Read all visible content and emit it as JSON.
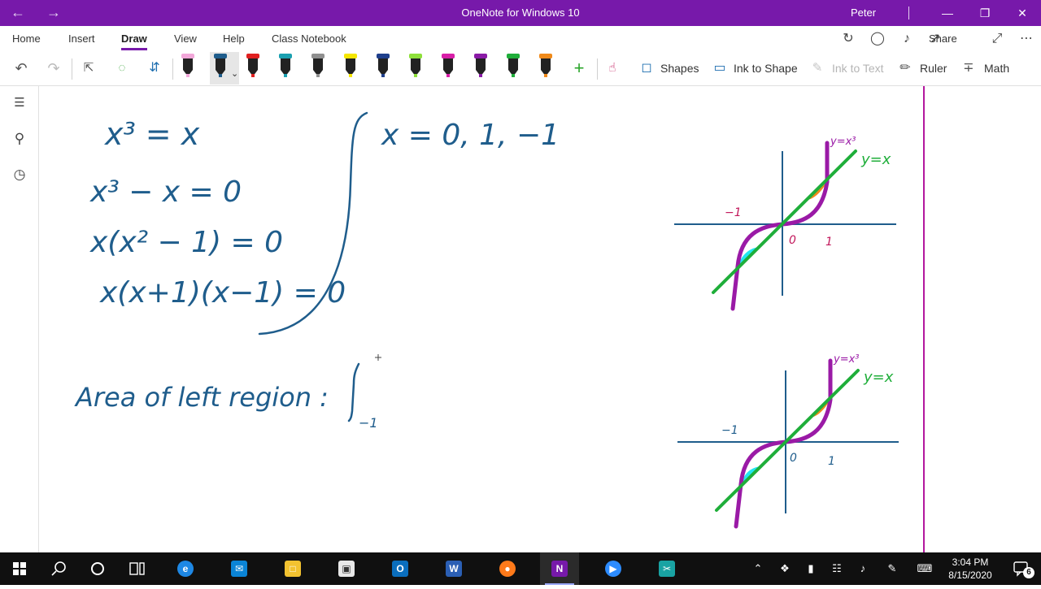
{
  "titlebar": {
    "title": "OneNote for Windows 10",
    "user": "Peter",
    "accent": "#7719aa"
  },
  "tabs": [
    {
      "label": "Home"
    },
    {
      "label": "Insert"
    },
    {
      "label": "Draw",
      "active": true
    },
    {
      "label": "View"
    },
    {
      "label": "Help"
    },
    {
      "label": "Class Notebook"
    }
  ],
  "ribbon_right": {
    "share_label": "Share",
    "icons": [
      "sync-icon",
      "lightbulb-icon",
      "bell-icon",
      "share-icon",
      "expand-icon",
      "more-icon"
    ]
  },
  "toolbar": {
    "shapes_label": "Shapes",
    "ink_to_shape_label": "Ink to Shape",
    "ink_to_text_label": "Ink to Text",
    "ruler_label": "Ruler",
    "math_label": "Math",
    "pens": [
      {
        "name": "highlighter-pink",
        "color": "#f2a7d9"
      },
      {
        "name": "pen-dark-blue",
        "color": "#1f5d8c",
        "selected": true
      },
      {
        "name": "pen-red",
        "color": "#e02020"
      },
      {
        "name": "pen-teal",
        "color": "#1aa0b0"
      },
      {
        "name": "pen-gray",
        "color": "#909090"
      },
      {
        "name": "highlighter-yellow",
        "color": "#f5e600"
      },
      {
        "name": "pen-navy",
        "color": "#1f3f8c"
      },
      {
        "name": "pen-lime",
        "color": "#8ee03a"
      },
      {
        "name": "pen-magenta",
        "color": "#d81fa8"
      },
      {
        "name": "pen-purple",
        "color": "#8a1aa6"
      },
      {
        "name": "pen-green",
        "color": "#1fae3a"
      },
      {
        "name": "highlighter-orange",
        "color": "#f08a1a"
      }
    ]
  },
  "notes": {
    "eq1": "x³ = x",
    "eq2": "x³ − x = 0",
    "eq3": "x(x² − 1) = 0",
    "eq4": "x(x+1)(x−1) = 0",
    "roots": "x = 0, 1, −1",
    "area_text": "Area of left region :",
    "integral_lower": "−1",
    "graph1": {
      "label_cubic": "y=x³",
      "label_line": "y=x",
      "tick_neg": "−1",
      "tick_zero": "0",
      "tick_pos": "1"
    },
    "graph2": {
      "label_cubic": "y=x³",
      "label_line": "y=x",
      "tick_neg": "−1",
      "tick_zero": "0",
      "tick_pos": "1"
    }
  },
  "ink_colors": {
    "pen": "#1f5d8c",
    "axis": "#1f5d8c",
    "cubic": "#9a1aa6",
    "line": "#1fae3a",
    "fill_left": "#22e6f0",
    "fill_right": "#f08a1a",
    "ticks": "#c2185b",
    "margin": "#b3179e"
  },
  "taskbar": {
    "time": "3:04 PM",
    "date": "8/15/2020",
    "notification_count": "6",
    "apps": [
      {
        "name": "windows-start-icon"
      },
      {
        "name": "search-icon"
      },
      {
        "name": "cortana-icon"
      },
      {
        "name": "task-view-icon"
      },
      {
        "name": "edge-icon"
      },
      {
        "name": "mail-icon"
      },
      {
        "name": "file-explorer-icon"
      },
      {
        "name": "store-icon"
      },
      {
        "name": "outlook-icon",
        "glyph": "O"
      },
      {
        "name": "word-icon",
        "glyph": "W"
      },
      {
        "name": "firefox-icon"
      },
      {
        "name": "onenote-icon",
        "glyph": "N",
        "active": true
      },
      {
        "name": "zoom-icon"
      },
      {
        "name": "snip-icon"
      }
    ]
  }
}
